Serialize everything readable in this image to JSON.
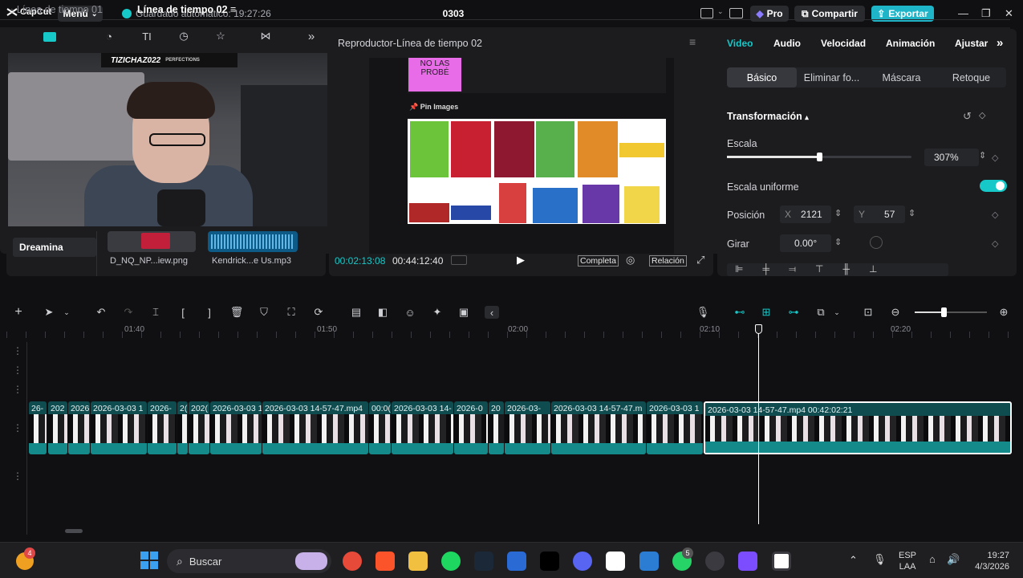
{
  "app": {
    "logo_text": "CapCut",
    "menu_label": "Menú",
    "autosave": "Guardado automático: 19:27:26",
    "title": "0303",
    "pro_label": "Pro",
    "share_label": "Compartir",
    "export_label": "Exportar",
    "win_min": "—",
    "win_max": "❐",
    "win_close": "✕"
  },
  "media": {
    "expand_icon": "»",
    "dreamina_label": "Dreamina",
    "items": [
      {
        "label": "D_NQ_NP...iew.png"
      },
      {
        "label": "Kendrick...e Us.mp3"
      }
    ],
    "webcam_banner": "TIZICHAZ022",
    "webcam_banner_sub": "PERFECTIONS"
  },
  "preview": {
    "title": "Reproductor-Línea de tiempo 02",
    "menu_icon": "≡",
    "sticky_text": "NO LAS PROBÉ",
    "pin_label": "Pin Images",
    "current_time": "00:02:13:08",
    "total_time": "00:44:12:40",
    "quality_label": "Completa",
    "ratio_label": "Relación"
  },
  "props": {
    "tabs": [
      {
        "label": "Video"
      },
      {
        "label": "Audio"
      },
      {
        "label": "Velocidad"
      },
      {
        "label": "Animación"
      },
      {
        "label": "Ajustar"
      }
    ],
    "more_icon": "»",
    "subtabs": [
      {
        "label": "Básico"
      },
      {
        "label": "Eliminar fo..."
      },
      {
        "label": "Máscara"
      },
      {
        "label": "Retoque"
      }
    ],
    "section_title": "Transformación",
    "scale_label": "Escala",
    "scale_value": "307%",
    "scale_fraction": 0.5,
    "uniform_label": "Escala uniforme",
    "position_label": "Posición",
    "x_label": "X",
    "x_value": "2121",
    "y_label": "Y",
    "y_value": "57",
    "rotate_label": "Girar",
    "rotate_value": "0.00°"
  },
  "timeline": {
    "tabs": [
      {
        "label": "Línea de tiempo 01"
      },
      {
        "label": "Línea de tiempo 02"
      }
    ],
    "ticks": [
      "01:40",
      "01:50",
      "02:00",
      "02:10",
      "02:20"
    ],
    "clips": [
      {
        "label": "26-"
      },
      {
        "label": "202"
      },
      {
        "label": "2026"
      },
      {
        "label": "2026-03-03 1"
      },
      {
        "label": "2026-"
      },
      {
        "label": "2("
      },
      {
        "label": "202("
      },
      {
        "label": "2026-03-03 1"
      },
      {
        "label": "2026-03-03 14-57-47.mp4"
      },
      {
        "label": "00:0("
      },
      {
        "label": "2026-03-03 14-"
      },
      {
        "label": "2026-0"
      },
      {
        "label": "20"
      },
      {
        "label": "2026-03-"
      },
      {
        "label": "2026-03-03 14-57-47.m"
      },
      {
        "label": "2026-03-03 1"
      },
      {
        "label": "2026-03-03 14-57-47.mp4   00:42:02:21"
      }
    ]
  },
  "taskbar": {
    "search_label": "Buscar",
    "lang": "ESP",
    "lang_sub": "LAA",
    "time": "19:27",
    "date": "4/3/2026",
    "badge_weather": "4",
    "badge_whatsapp": "5"
  },
  "colors": {
    "accent": "#16c8c8",
    "export": "#1fb5c9",
    "clip": "#0f4c50",
    "pro": "#6b5bd6"
  }
}
